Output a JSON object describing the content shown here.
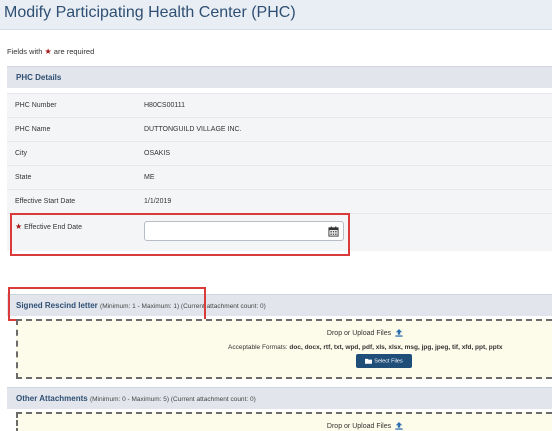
{
  "page": {
    "title": "Modify Participating Health Center (PHC)"
  },
  "required_note": {
    "prefix": "Fields with",
    "suffix": "are required",
    "star": "★"
  },
  "phc_details": {
    "title": "PHC Details",
    "fields": [
      {
        "label": "PHC Number",
        "value": "H80CS00111"
      },
      {
        "label": "PHC Name",
        "value": "DUTTONGUILD VILLAGE INC."
      },
      {
        "label": "City",
        "value": "OSAKIS"
      },
      {
        "label": "State",
        "value": "ME"
      },
      {
        "label": "Effective Start Date",
        "value": "1/1/2019"
      }
    ],
    "end_date": {
      "label": "Effective End Date",
      "value": ""
    }
  },
  "signed_rescind": {
    "title": "Signed Rescind letter",
    "meta": "(Minimum: 1 - Maximum: 1) (Current attachment count: 0)",
    "drop_label": "Drop or Upload Files",
    "formats_label": "Acceptable Formats:",
    "formats": "doc, docx, rtf, txt, wpd, pdf, xls, xlsx, msg, jpg, jpeg, tif, xfd, ppt, pptx",
    "button": "Select Files"
  },
  "other_attachments": {
    "title": "Other Attachments",
    "meta": "(Minimum: 0 - Maximum: 5) (Current attachment count: 0)",
    "drop_label": "Drop or Upload Files"
  },
  "colors": {
    "accent": "#2f4f73",
    "button": "#1f4e79",
    "highlight": "#d93a3a",
    "required": "#a31515",
    "dropzone": "#fdfbe9"
  },
  "icons": {
    "upload": "upload-icon",
    "calendar": "calendar-icon",
    "folder": "folder-icon"
  }
}
